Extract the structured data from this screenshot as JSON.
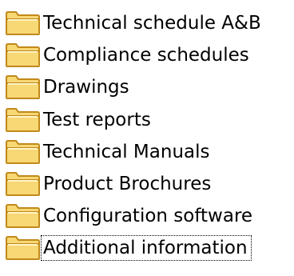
{
  "folder_tree": {
    "items": [
      {
        "label": "Technical schedule A&B",
        "icon": "folder-icon"
      },
      {
        "label": "Compliance schedules",
        "icon": "folder-icon"
      },
      {
        "label": "Drawings",
        "icon": "folder-icon"
      },
      {
        "label": "Test reports",
        "icon": "folder-icon"
      },
      {
        "label": "Technical Manuals",
        "icon": "folder-icon"
      },
      {
        "label": "Product Brochures",
        "icon": "folder-icon"
      },
      {
        "label": "Configuration software",
        "icon": "folder-icon"
      },
      {
        "label": "Additional information",
        "icon": "folder-icon",
        "focused": true
      }
    ]
  },
  "colors": {
    "folder_fill": "#F8D775",
    "folder_outline": "#C08A1A",
    "text": "#000000",
    "background": "#FFFFFF"
  }
}
